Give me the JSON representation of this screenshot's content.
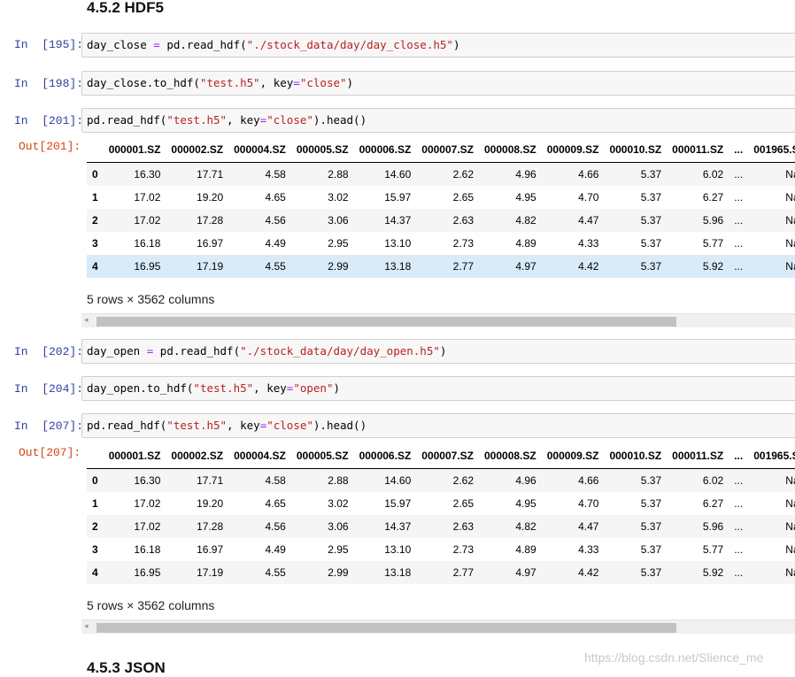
{
  "headings": {
    "h1": "4.5.2 HDF5",
    "h2": "4.5.3 JSON"
  },
  "cells": [
    {
      "prompt": "In  [195]:",
      "code": [
        [
          "day_close ",
          ""
        ],
        [
          "=",
          "op"
        ],
        [
          " pd.read_hdf(",
          ""
        ],
        [
          "\"./stock_data/day/day_close.h5\"",
          "str"
        ],
        [
          ")",
          ""
        ]
      ]
    },
    {
      "prompt": "In  [198]:",
      "code": [
        [
          "day_close.to_hdf(",
          ""
        ],
        [
          "\"test.h5\"",
          "str"
        ],
        [
          ", key",
          ""
        ],
        [
          "=",
          "op"
        ],
        [
          "\"close\"",
          "str"
        ],
        [
          ")",
          ""
        ]
      ]
    },
    {
      "prompt": "In  [201]:",
      "code": [
        [
          "pd.read_hdf(",
          ""
        ],
        [
          "\"test.h5\"",
          "str"
        ],
        [
          ", key",
          ""
        ],
        [
          "=",
          "op"
        ],
        [
          "\"close\"",
          "str"
        ],
        [
          ").head()",
          ""
        ]
      ]
    },
    {
      "prompt": "In  [202]:",
      "code": [
        [
          "day_open ",
          ""
        ],
        [
          "=",
          "op"
        ],
        [
          " pd.read_hdf(",
          ""
        ],
        [
          "\"./stock_data/day/day_open.h5\"",
          "str"
        ],
        [
          ")",
          ""
        ]
      ]
    },
    {
      "prompt": "In  [204]:",
      "code": [
        [
          "day_open.to_hdf(",
          ""
        ],
        [
          "\"test.h5\"",
          "str"
        ],
        [
          ", key",
          ""
        ],
        [
          "=",
          "op"
        ],
        [
          "\"open\"",
          "str"
        ],
        [
          ")",
          ""
        ]
      ]
    },
    {
      "prompt": "In  [207]:",
      "code": [
        [
          "pd.read_hdf(",
          ""
        ],
        [
          "\"test.h5\"",
          "str"
        ],
        [
          ", key",
          ""
        ],
        [
          "=",
          "op"
        ],
        [
          "\"close\"",
          "str"
        ],
        [
          ").head()",
          ""
        ]
      ]
    }
  ],
  "outputs": [
    {
      "prompt": "Out[201]:",
      "summary": "5 rows × 3562 columns",
      "highlight_row": 4
    },
    {
      "prompt": "Out[207]:",
      "summary": "5 rows × 3562 columns",
      "highlight_row": -1
    }
  ],
  "dataframe": {
    "columns": [
      "000001.SZ",
      "000002.SZ",
      "000004.SZ",
      "000005.SZ",
      "000006.SZ",
      "000007.SZ",
      "000008.SZ",
      "000009.SZ",
      "000010.SZ",
      "000011.SZ",
      "...",
      "001965.S"
    ],
    "index": [
      "0",
      "1",
      "2",
      "3",
      "4"
    ],
    "rows": [
      [
        "16.30",
        "17.71",
        "4.58",
        "2.88",
        "14.60",
        "2.62",
        "4.96",
        "4.66",
        "5.37",
        "6.02",
        "...",
        "Na"
      ],
      [
        "17.02",
        "19.20",
        "4.65",
        "3.02",
        "15.97",
        "2.65",
        "4.95",
        "4.70",
        "5.37",
        "6.27",
        "...",
        "Na"
      ],
      [
        "17.02",
        "17.28",
        "4.56",
        "3.06",
        "14.37",
        "2.63",
        "4.82",
        "4.47",
        "5.37",
        "5.96",
        "...",
        "Na"
      ],
      [
        "16.18",
        "16.97",
        "4.49",
        "2.95",
        "13.10",
        "2.73",
        "4.89",
        "4.33",
        "5.37",
        "5.77",
        "...",
        "Na"
      ],
      [
        "16.95",
        "17.19",
        "4.55",
        "2.99",
        "13.18",
        "2.77",
        "4.97",
        "4.42",
        "5.37",
        "5.92",
        "...",
        "Na"
      ]
    ]
  },
  "scrollbar": {
    "left_arrow": "◂"
  },
  "watermark": "https://blog.csdn.net/Slience_me",
  "colors": {
    "input_prompt": "#303f9f",
    "output_prompt": "#d84315",
    "string": "#ba2121",
    "operator": "#aa22ff",
    "row_highlight": "#d9ebf9"
  }
}
